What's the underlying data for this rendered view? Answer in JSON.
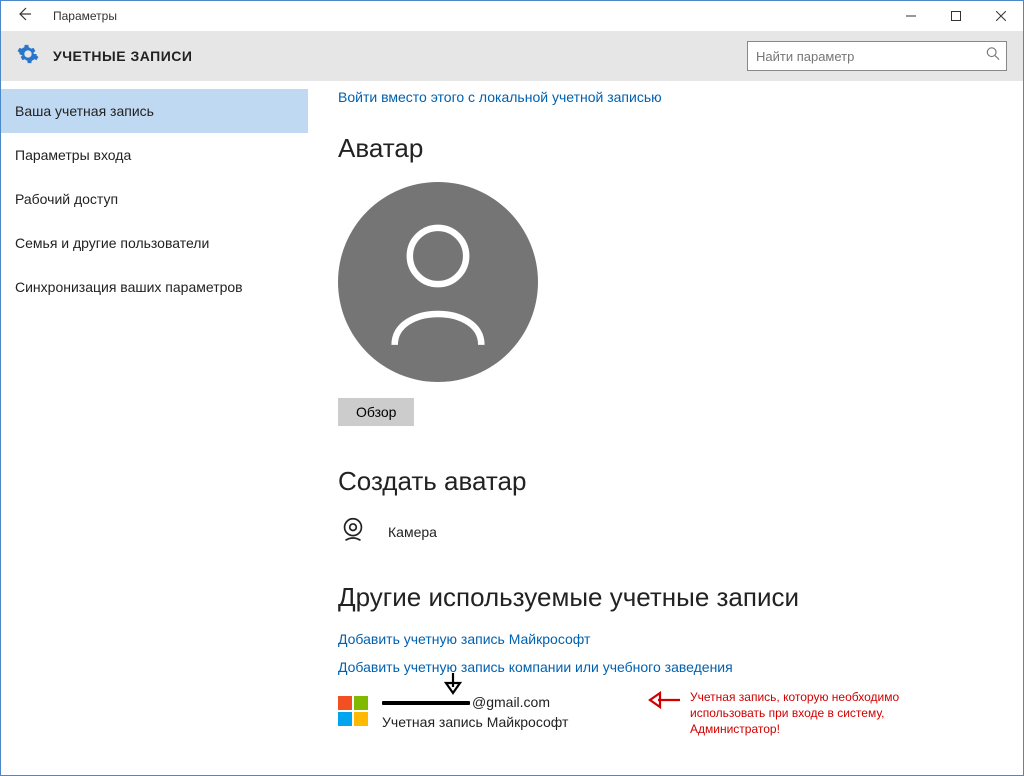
{
  "window": {
    "title": "Параметры"
  },
  "header": {
    "title": "УЧЕТНЫЕ ЗАПИСИ",
    "search_placeholder": "Найти параметр"
  },
  "sidebar": {
    "items": [
      {
        "label": "Ваша учетная запись",
        "active": true
      },
      {
        "label": "Параметры входа",
        "active": false
      },
      {
        "label": "Рабочий доступ",
        "active": false
      },
      {
        "label": "Семья и другие пользователи",
        "active": false
      },
      {
        "label": "Синхронизация ваших параметров",
        "active": false
      }
    ]
  },
  "main": {
    "top_link": "Войти вместо этого с локальной учетной записью",
    "avatar_section": "Аватар",
    "browse_button": "Обзор",
    "create_avatar_section": "Создать аватар",
    "camera_label": "Камера",
    "other_accounts_section": "Другие используемые учетные записи",
    "add_ms_link": "Добавить учетную запись Майкрософт",
    "add_work_link": "Добавить учетную запись компании или учебного заведения",
    "account": {
      "email_suffix": "@gmail.com",
      "type_label": "Учетная запись Майкрософт"
    },
    "annotation": "Учетная запись, которую необходимо использовать при входе в систему, Администратор!"
  }
}
